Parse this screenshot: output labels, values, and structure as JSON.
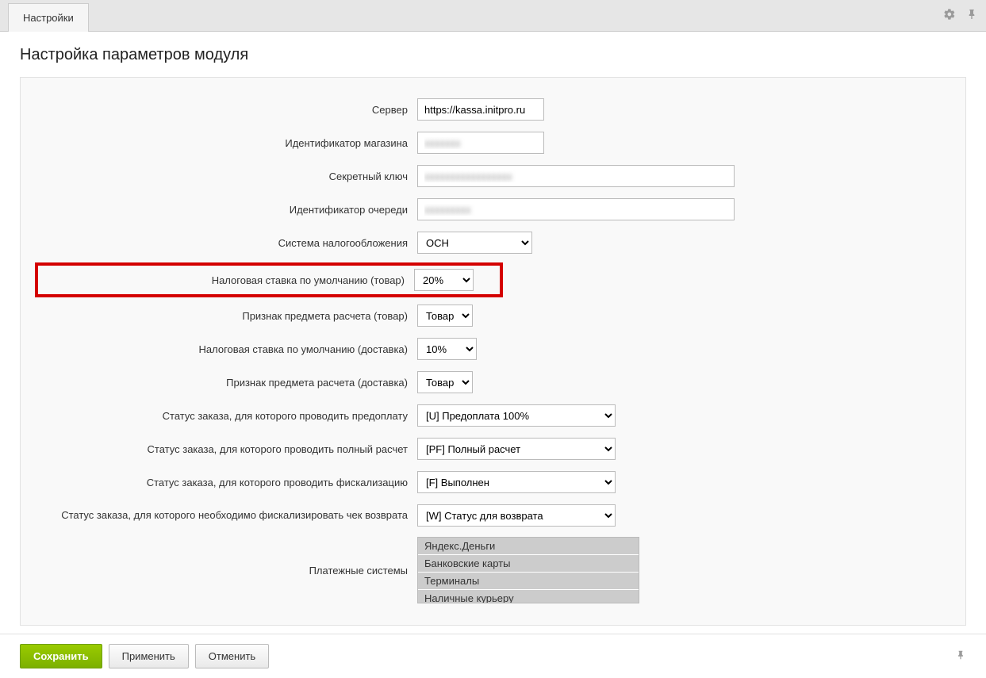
{
  "tabs": {
    "settings": "Настройки"
  },
  "page": {
    "title": "Настройка параметров модуля"
  },
  "form": {
    "server": {
      "label": "Сервер",
      "value": "https://kassa.initpro.ru"
    },
    "shop_id": {
      "label": "Идентификатор магазина",
      "value": "xxxxxxx"
    },
    "secret_key": {
      "label": "Секретный ключ",
      "value": "xxxxxxxxxxxxxxxxx"
    },
    "queue_id": {
      "label": "Идентификатор очереди",
      "value": "xxxxxxxxx"
    },
    "tax_system": {
      "label": "Система налогообложения",
      "value": "ОСН"
    },
    "default_tax_goods": {
      "label": "Налоговая ставка по умолчанию (товар)",
      "value": "20%"
    },
    "item_subject_goods": {
      "label": "Признак предмета расчета (товар)",
      "value": "Товар"
    },
    "default_tax_delivery": {
      "label": "Налоговая ставка по умолчанию (доставка)",
      "value": "10%"
    },
    "item_subject_delivery": {
      "label": "Признак предмета расчета (доставка)",
      "value": "Товар"
    },
    "status_prepay": {
      "label": "Статус заказа, для которого проводить предоплату",
      "value": "[U] Предоплата 100%"
    },
    "status_full_pay": {
      "label": "Статус заказа, для которого проводить полный расчет",
      "value": "[PF] Полный расчет"
    },
    "status_fiscal": {
      "label": "Статус заказа, для которого проводить фискализацию",
      "value": "[F] Выполнен"
    },
    "status_refund": {
      "label": "Статус заказа, для которого необходимо фискализировать чек возврата",
      "value": "[W] Статус для возврата"
    },
    "payment_systems": {
      "label": "Платежные системы",
      "options": [
        "Яндекс.Деньги",
        "Банковские карты",
        "Терминалы",
        "Наличные курьеру"
      ]
    }
  },
  "footer": {
    "save": "Сохранить",
    "apply": "Применить",
    "cancel": "Отменить"
  }
}
